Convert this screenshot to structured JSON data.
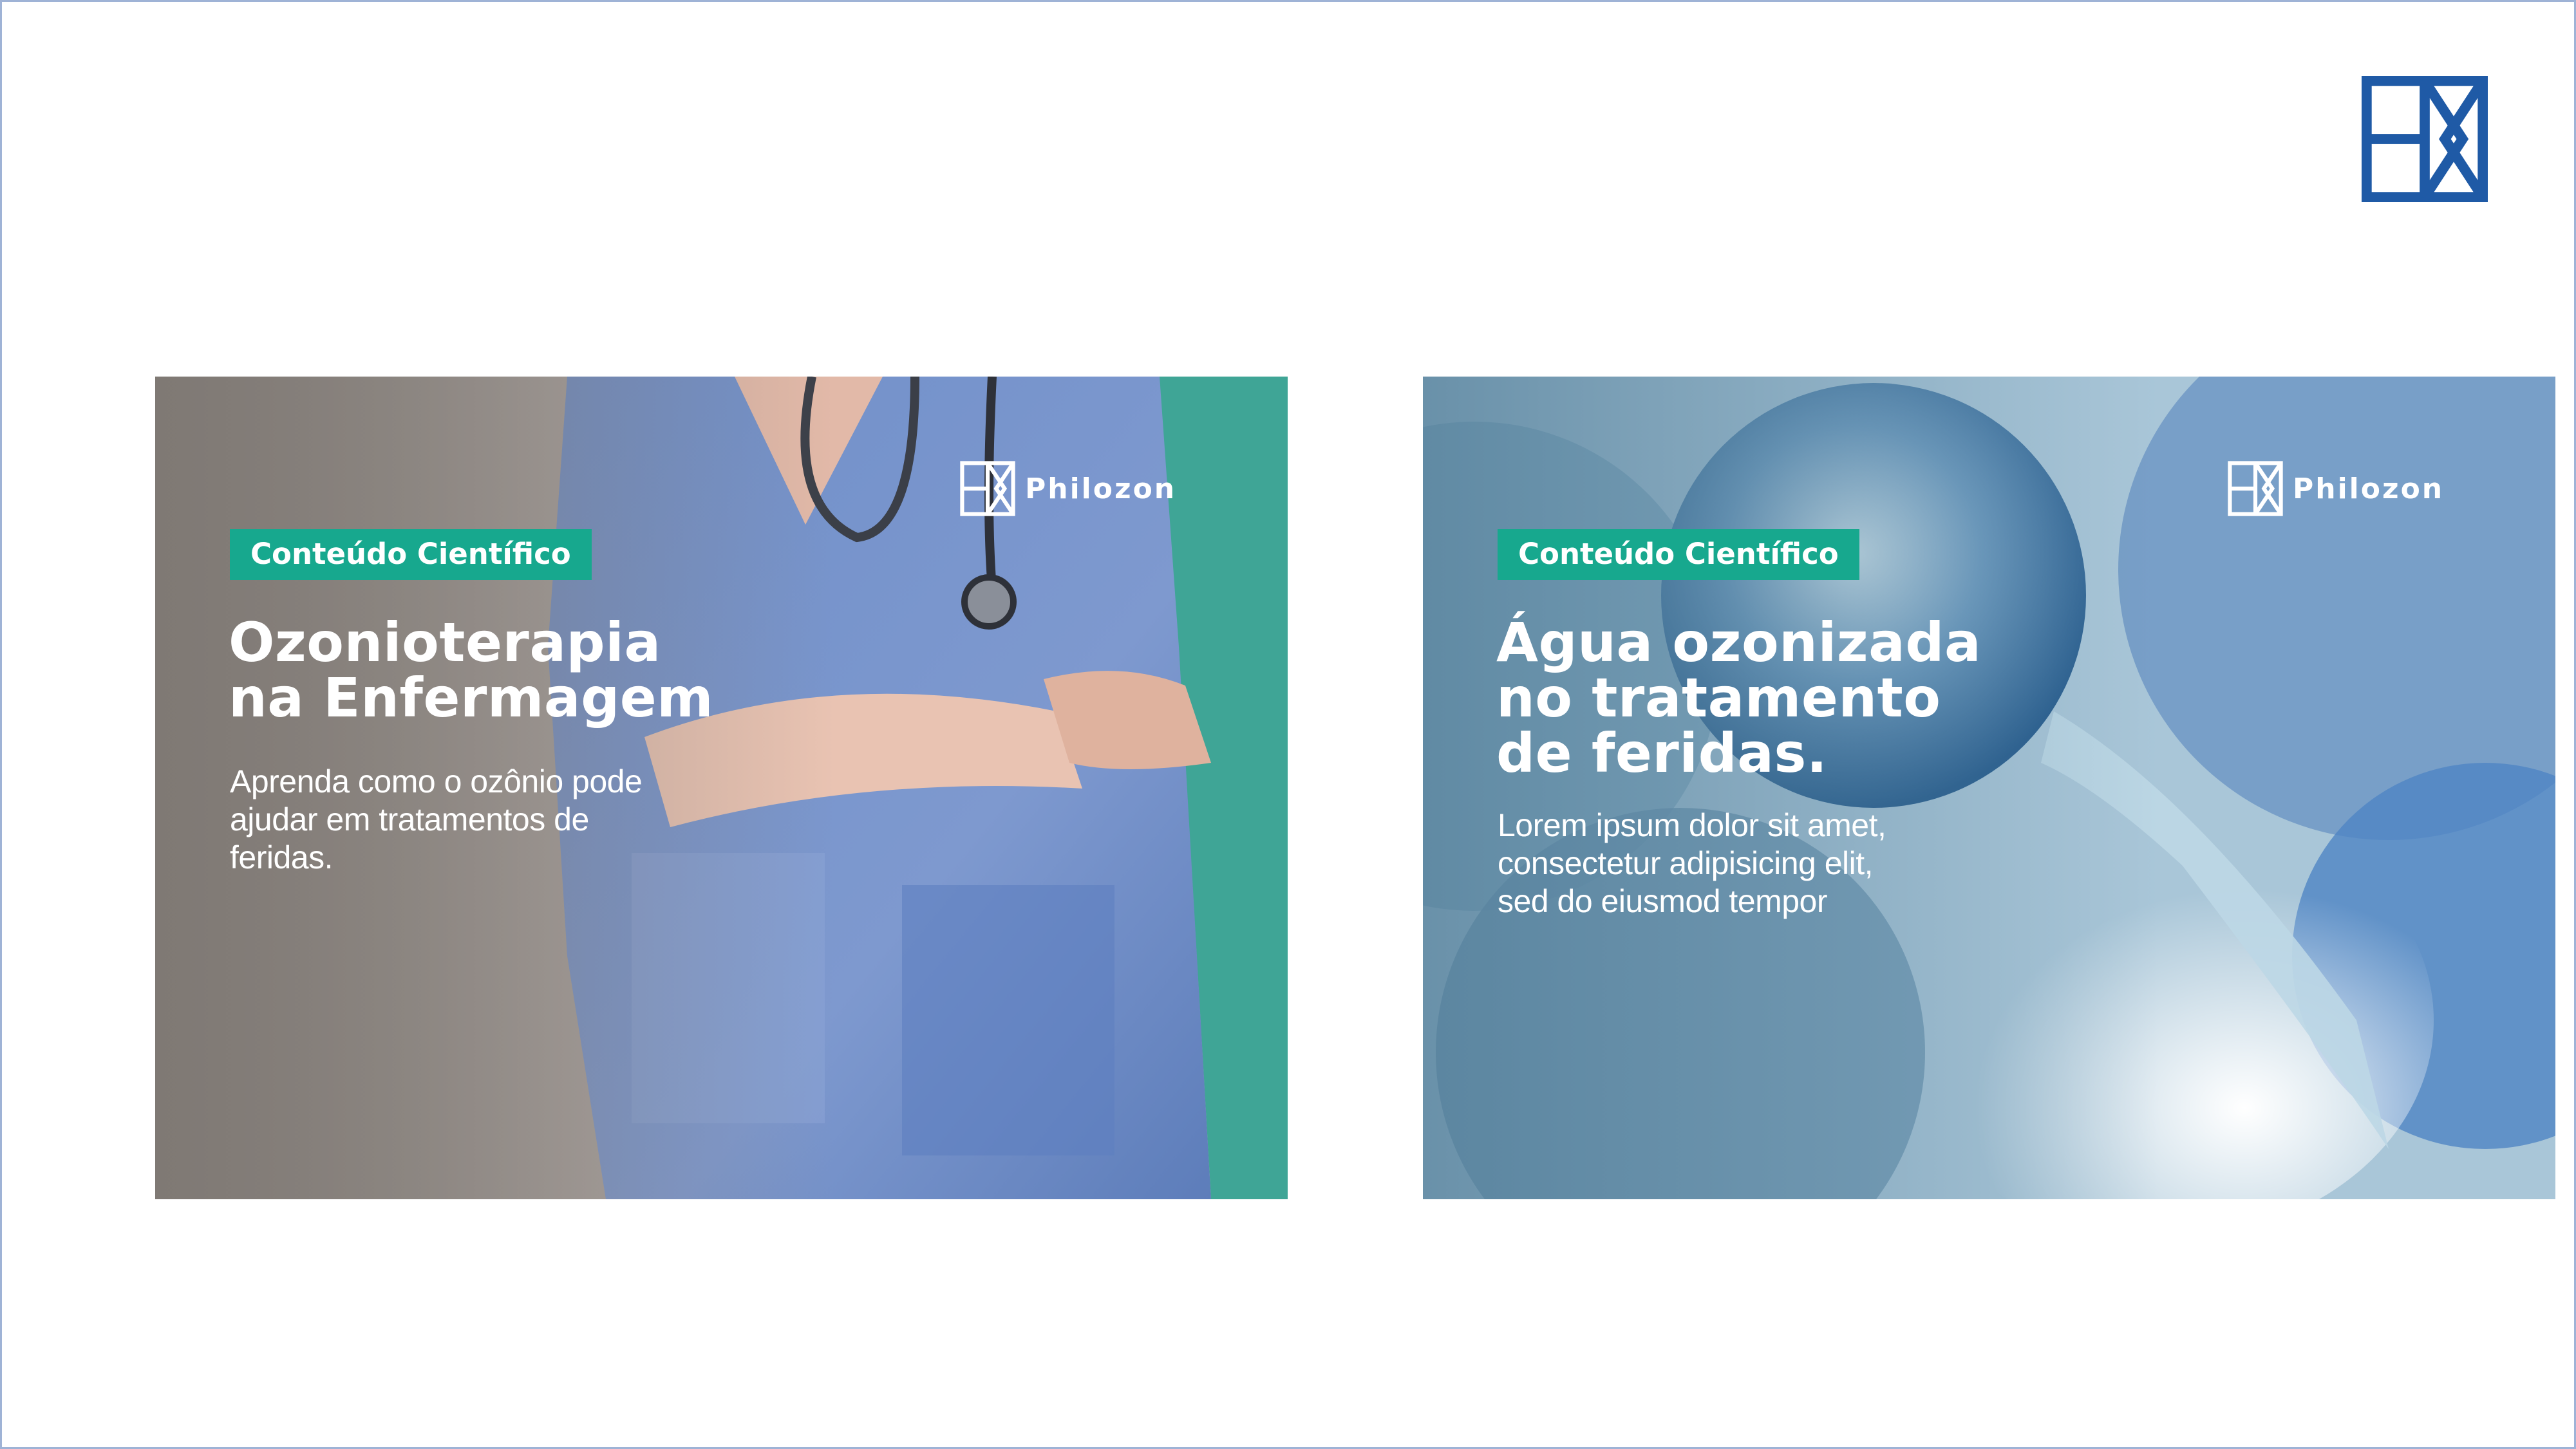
{
  "colors": {
    "brand_blue": "#1f5aa6",
    "badge_teal": "#17a88e",
    "text_white": "#ffffff"
  },
  "icons": {
    "corner_logo": "philozon-mark-icon",
    "brand_mark": "philozon-mark-icon"
  },
  "banners": [
    {
      "spine_label": "Conteúdo Científico",
      "brand_name": "Philozon",
      "badge": "Conteúdo Científico",
      "headline_lines": [
        "Ozonioterapia",
        "na Enfermagem"
      ],
      "body_lines": [
        "Aprenda como o ozônio pode",
        "ajudar em tratamentos de",
        "feridas."
      ]
    },
    {
      "spine_label": "Conteúdo Científico",
      "brand_name": "Philozon",
      "badge": "Conteúdo Científico",
      "headline_lines": [
        "Água ozonizada",
        "no tratamento",
        "de feridas."
      ],
      "body_lines": [
        "Lorem ipsum dolor sit amet,",
        "consectetur adipisicing elit,",
        "sed do eiusmod tempor"
      ]
    }
  ]
}
